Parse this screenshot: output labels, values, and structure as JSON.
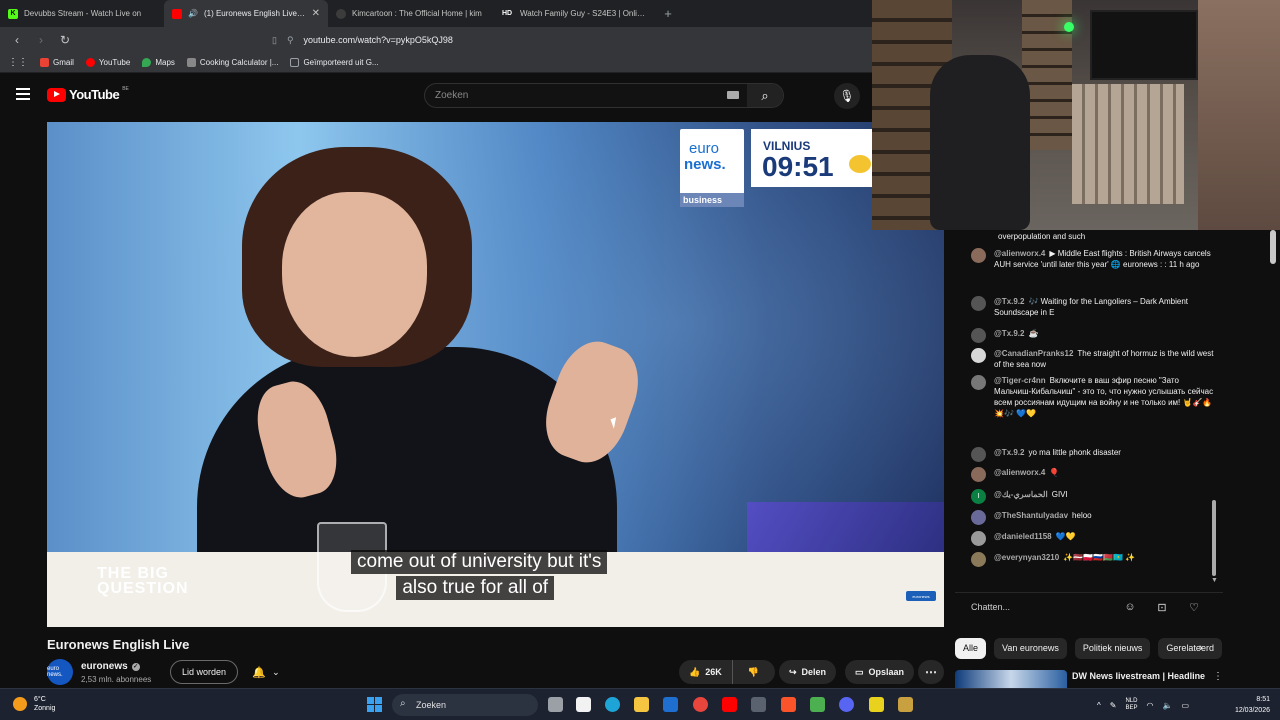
{
  "browser": {
    "tabs": [
      {
        "title": "Devubbs Stream - Watch Live on",
        "fav_color": "#53fc18",
        "fav_text": "K"
      },
      {
        "title": "(1) Euronews English Live - Yo",
        "fav_color": "#ff0000",
        "fav_text": "",
        "active": true
      },
      {
        "title": "Kimcartoon : The Official Home | kim",
        "fav_color": "#3c3c3c",
        "fav_text": ""
      },
      {
        "title": "Watch Family Guy - S24E3 | Online H",
        "fav_color": "#202124",
        "fav_text": "HD"
      }
    ],
    "url": "youtube.com/watch?v=pykpO5kQJ98",
    "bookmarks": [
      {
        "label": "Gmail",
        "color": "#ea4335"
      },
      {
        "label": "YouTube",
        "color": "#ff0000"
      },
      {
        "label": "Maps",
        "color": "#34a853"
      },
      {
        "label": "Cooking Calculator |...",
        "color": "#888888"
      },
      {
        "label": "Geïmporteerd uit G...",
        "color": "#9aa0a6"
      }
    ]
  },
  "youtube": {
    "logo_text": "YouTube",
    "country": "BE",
    "search_placeholder": "Zoeken"
  },
  "video": {
    "channel_logo_line1": "euro",
    "channel_logo_line2": "news.",
    "channel_logo_section": "business",
    "city": "VILNIUS",
    "time": "09:51",
    "program": "THE BIG\nQUESTION",
    "subtitle_line1": "come out of university but it's",
    "subtitle_line2": "also true for all of",
    "watermark": "euronews"
  },
  "meta": {
    "title": "Euronews English Live",
    "channel": "euronews",
    "channel_avatar": "euro news.",
    "subscribers": "2,53 mln. abonnees",
    "join_label": "Lid worden",
    "likes": "26K",
    "share_label": "Delen",
    "save_label": "Opslaan"
  },
  "chat": {
    "top_line": "overpopulation and such",
    "messages": [
      {
        "author": "@alienworx.4",
        "text": "▶ Middle East flights : British Airways cancels AUH service 'until later this year' 🌐 euronews : : 11 h ago",
        "color": "#8a6a5a"
      },
      {
        "author": "@Tx.9.2",
        "text": "🎶 Waiting for the Langoliers – Dark Ambient Soundscape in E",
        "color": "#555555"
      },
      {
        "author": "@Tx.9.2",
        "text": "☕",
        "color": "#555555"
      },
      {
        "author": "@CanadianPranks12",
        "text": "The straight of hormuz is the wild west of the sea now",
        "color": "#d8d8d8"
      },
      {
        "author": "@Tiger-cr4nn",
        "text": "Включите в ваш эфир песню \"Зато Мальчиш-Кибальчиш\" - это то, что нужно услышать сейчас всем россиянам идущим на войну и не только им! 🤘🎸🔥💥🎶 💙💛",
        "color": "#777777"
      },
      {
        "author": "@Tx.9.2",
        "text": "yo ma little phonk disaster",
        "color": "#555555"
      },
      {
        "author": "@alienworx.4",
        "text": "🎈",
        "color": "#8a6a5a"
      },
      {
        "author": "@الحماسري-يك",
        "text": "GIVI",
        "color": "#0b8043"
      },
      {
        "author": "@TheShantulyadav",
        "text": "heloo",
        "color": "#6a6a9a"
      },
      {
        "author": "@danieled1158",
        "text": "💙💛",
        "color": "#9a9a9a"
      },
      {
        "author": "@everynyan3210",
        "text": "✨🇱🇻🇵🇱🇷🇺🇧🇾🇰🇿 ✨",
        "color": "#8a7a5a"
      }
    ],
    "input_placeholder": "Chatten..."
  },
  "chips": [
    "Alle",
    "Van euronews",
    "Politiek nieuws",
    "Gerelateerd"
  ],
  "recommended": {
    "title": "DW News livestream | Headline"
  },
  "taskbar": {
    "temperature": "6°C",
    "weather": "Zonnig",
    "search_label": "Zoeken",
    "lang_top": "NLD",
    "lang_bottom": "BEP",
    "time": "8:51",
    "date": "12/03/2026"
  }
}
